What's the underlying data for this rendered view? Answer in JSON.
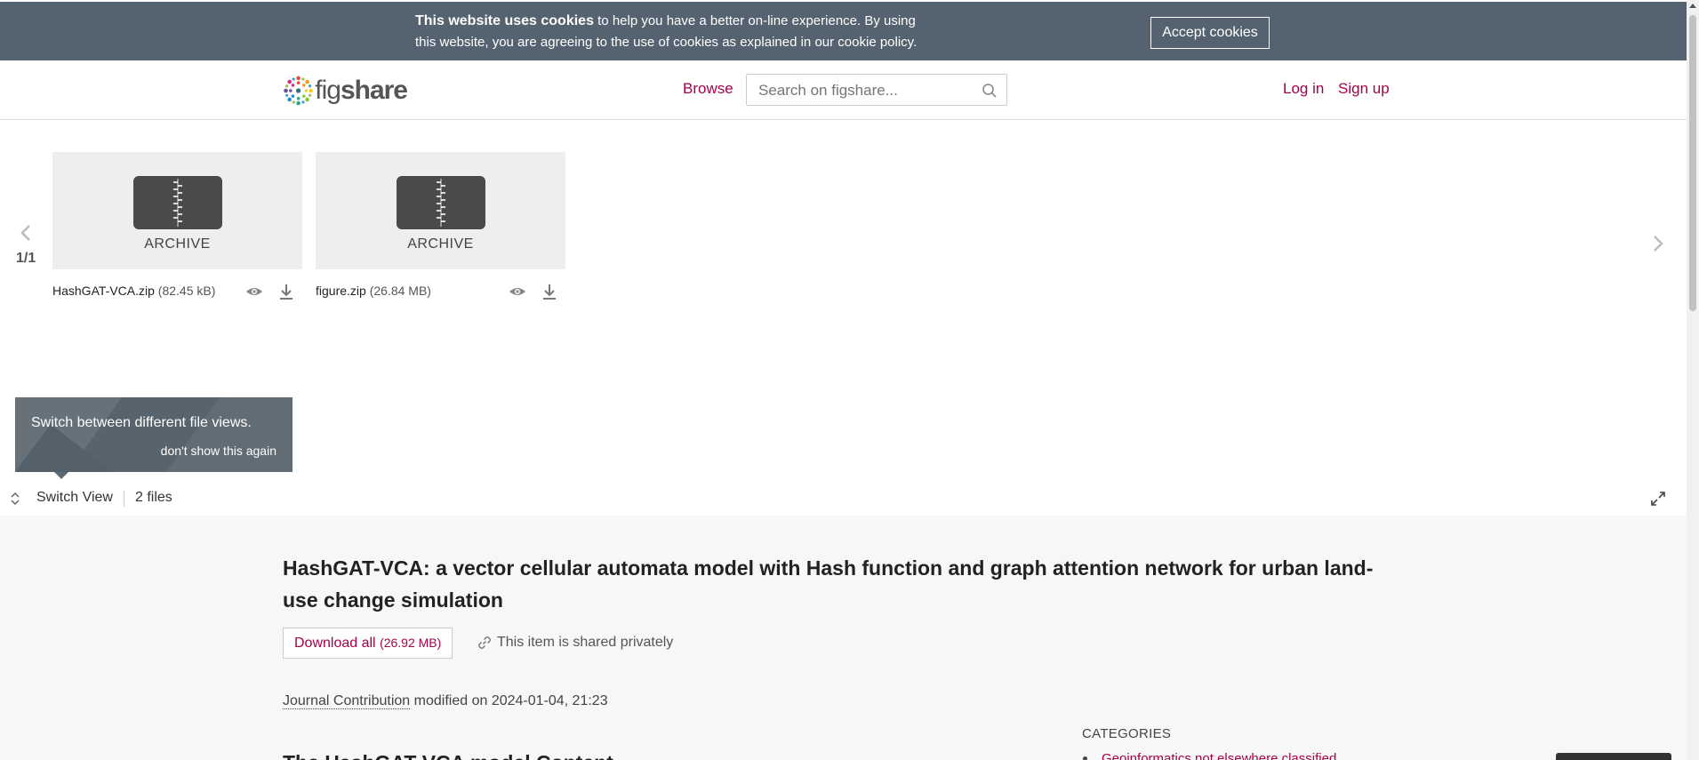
{
  "cookie_bar": {
    "bold": "This website uses cookies",
    "text": " to help you have a better on-line experience. By using this website, you are agreeing to the use of cookies as explained in our ",
    "link": "cookie policy",
    "end": ".",
    "accept": "Accept cookies"
  },
  "header": {
    "logo_a": "fig",
    "logo_b": "share",
    "browse": "Browse",
    "search_placeholder": "Search on figshare...",
    "login": "Log in",
    "signup": "Sign up"
  },
  "carousel": {
    "pager": "1/1",
    "files": [
      {
        "type_label": "ARCHIVE",
        "name": "HashGAT-VCA.zip",
        "size": "(82.45 kB)"
      },
      {
        "type_label": "ARCHIVE",
        "name": "figure.zip",
        "size": "(26.84 MB)"
      }
    ]
  },
  "tooltip": {
    "text": "Switch between different file views.",
    "dismiss": "don't show this again"
  },
  "viewbar": {
    "switch_view": "Switch View",
    "files_count": "2 files"
  },
  "item": {
    "title": "HashGAT-VCA: a vector cellular automata model with Hash function and graph attention network for urban land-use change simulation",
    "download_label": "Download all",
    "download_size": "(26.92 MB)",
    "shared": "This item is shared privately",
    "type": "Journal Contribution",
    "modified": " modified on 2024-01-04, 21:23",
    "categories_label": "CATEGORIES",
    "category_1": "Geoinformatics not elsewhere classified",
    "subheading": "The HashGAT-VCA model Content"
  },
  "colors": {
    "accent": "#a6004b",
    "cookie_bg": "#556370"
  }
}
